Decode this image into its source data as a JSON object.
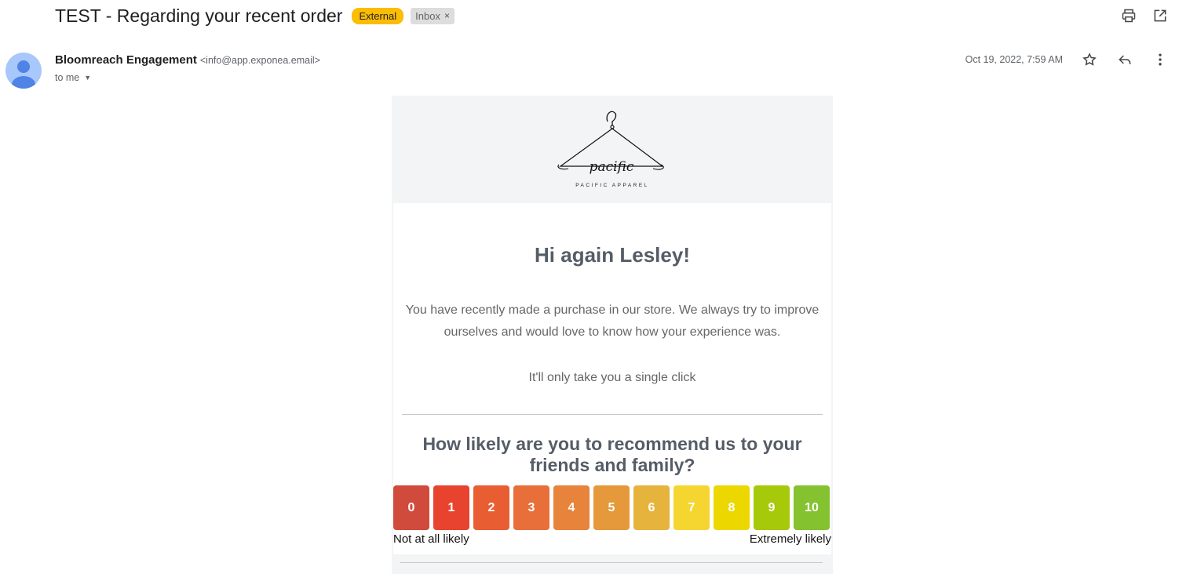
{
  "header": {
    "subject": "TEST - Regarding your recent order",
    "labels": {
      "external": "External",
      "inbox": "Inbox",
      "inbox_remove": "×"
    },
    "icons": [
      "print-icon",
      "open-in-new-window-icon"
    ]
  },
  "sender": {
    "name": "Bloomreach Engagement",
    "email": "<info@app.exponea.email>",
    "recipient": "to me",
    "date": "Oct 19, 2022, 7:59 AM",
    "icons": [
      "star-icon",
      "reply-icon",
      "more-vert-icon"
    ]
  },
  "email_body": {
    "brand_logo_text": "pacific",
    "brand_caption": "PACIFIC APPAREL",
    "greeting": "Hi again Lesley!",
    "paragraph_line1": "You have recently made a purchase in our store. We always try to improve",
    "paragraph_line2": "ourselves and would love to know how your experience was.",
    "single_click": "It'll only take you a single click",
    "question_line1": "How likely are you to recommend us to your",
    "question_line2": "friends and family?",
    "scale": [
      {
        "label": "0",
        "color": "#d14b3c"
      },
      {
        "label": "1",
        "color": "#e8432f"
      },
      {
        "label": "2",
        "color": "#e85e32"
      },
      {
        "label": "3",
        "color": "#e96f3a"
      },
      {
        "label": "4",
        "color": "#e8833b"
      },
      {
        "label": "5",
        "color": "#e5993a"
      },
      {
        "label": "6",
        "color": "#e6b33d"
      },
      {
        "label": "7",
        "color": "#f5d630"
      },
      {
        "label": "8",
        "color": "#ecd700"
      },
      {
        "label": "9",
        "color": "#a6c90a"
      },
      {
        "label": "10",
        "color": "#84c22f"
      }
    ],
    "scale_low_label": "Not at all likely",
    "scale_high_label": "Extremely likely"
  }
}
